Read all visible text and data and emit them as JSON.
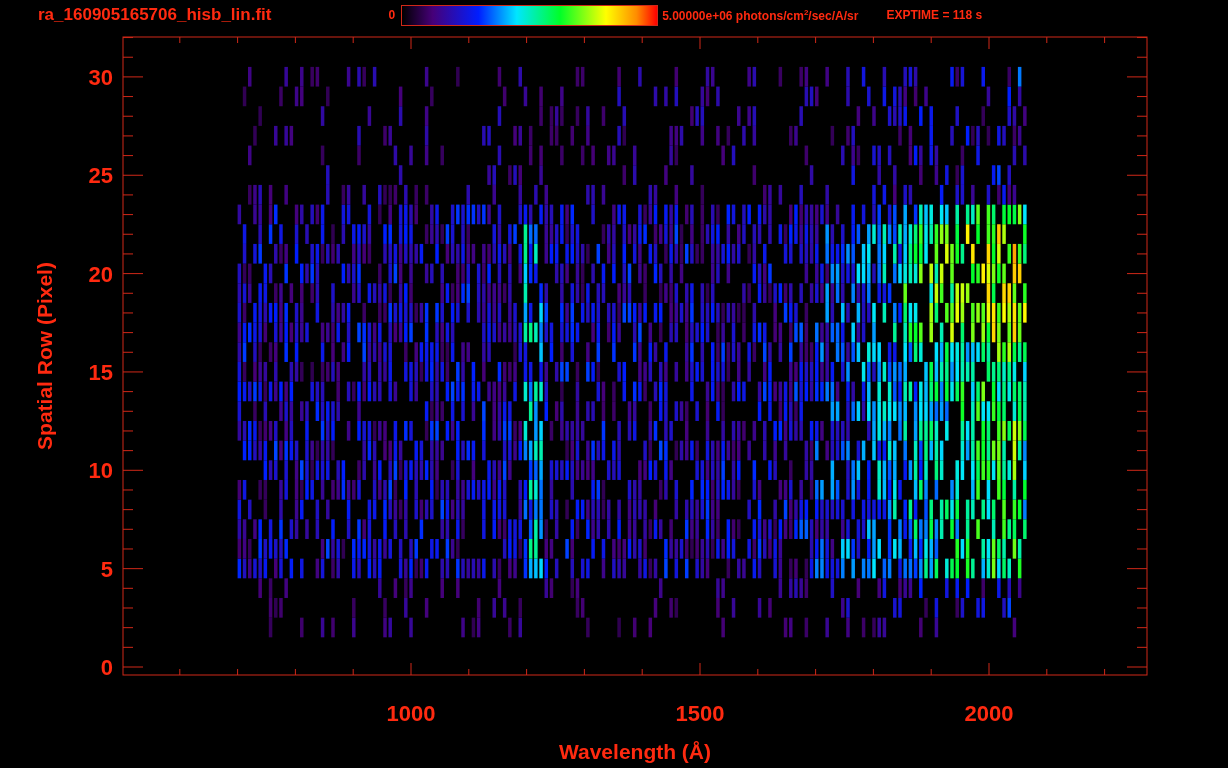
{
  "title": "ra_160905165706_hisb_lin.fit",
  "colorbar": {
    "min_label": "0",
    "max_label": "5.00000e+06 photons/cm$^{2}$/sec/A/sr"
  },
  "exposure": "EXPTIME = 118 s",
  "plot": {
    "xlabel": "Wavelength (Å)",
    "ylabel": "Spatial Row (Pixel)",
    "xtick_labels": [
      "1000",
      "1500",
      "2000"
    ],
    "ytick_labels": [
      "30",
      "25",
      "20",
      "15",
      "10",
      "5",
      "0"
    ]
  }
}
